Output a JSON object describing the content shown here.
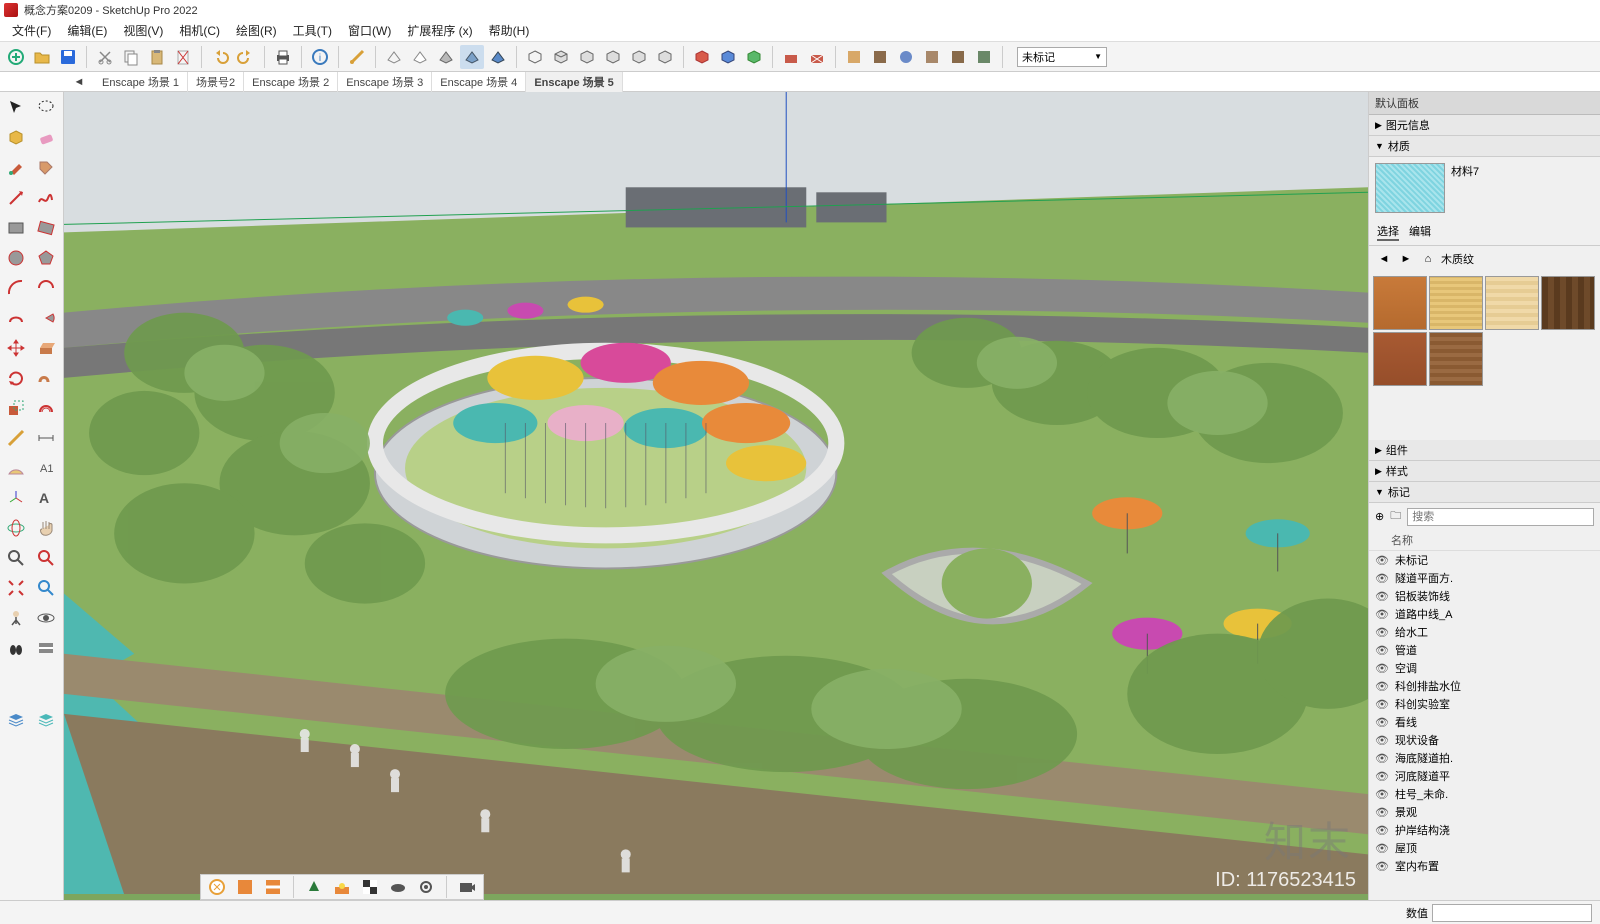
{
  "title": "概念方案0209 - SketchUp Pro 2022",
  "menu": [
    "文件(F)",
    "编辑(E)",
    "视图(V)",
    "相机(C)",
    "绘图(R)",
    "工具(T)",
    "窗口(W)",
    "扩展程序 (x)",
    "帮助(H)"
  ],
  "tag_dropdown": "未标记",
  "scene_tabs": [
    "Enscape 场景 1",
    "场景号2",
    "Enscape 场景 2",
    "Enscape 场景 3",
    "Enscape 场景 4",
    "Enscape 场景 5"
  ],
  "active_scene": 5,
  "tray": {
    "title": "默认面板",
    "sections": {
      "entity_info": "图元信息",
      "materials": "材质",
      "components": "组件",
      "styles": "样式",
      "tags": "标记"
    },
    "material_name": "材料7",
    "mat_tabs": [
      "选择",
      "编辑"
    ],
    "mat_category": "木质纹",
    "search_placeholder": "搜索",
    "tag_header": "名称",
    "tag_items": [
      "未标记",
      "隧道平面方.",
      "铝板装饰线",
      "道路中线_A",
      "给水工",
      "管道",
      "空调",
      "科创排盐水位",
      "科创实验室",
      "看线",
      "现状设备",
      "海底隧道拍.",
      "河底隧道平",
      "柱号_未命.",
      "景观",
      "护岸结构浇",
      "屋顶",
      "室内布置"
    ]
  },
  "status": {
    "label": "数值"
  },
  "watermark": "知末",
  "id_text": "ID: 1176523415"
}
